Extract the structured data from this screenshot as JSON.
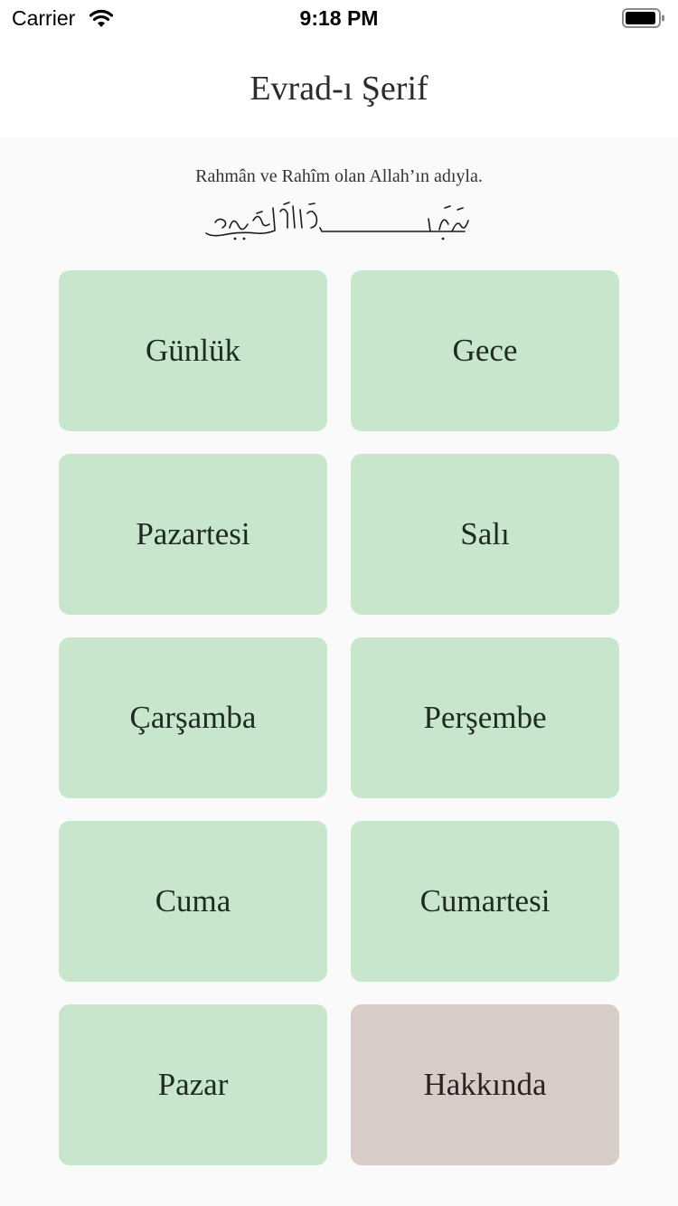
{
  "status_bar": {
    "carrier": "Carrier",
    "time": "9:18 PM",
    "wifi_icon": "wifi-icon",
    "battery_icon": "battery-icon"
  },
  "nav": {
    "title": "Evrad-ı Şerif"
  },
  "header": {
    "subtitle": "Rahmân ve Rahîm olan Allah’ın adıyla.",
    "calligraphy_icon": "besmele-calligraphy"
  },
  "tiles": [
    {
      "label": "Günlük"
    },
    {
      "label": "Gece"
    },
    {
      "label": "Pazartesi"
    },
    {
      "label": "Salı"
    },
    {
      "label": "Çarşamba"
    },
    {
      "label": "Perşembe"
    },
    {
      "label": "Cuma"
    },
    {
      "label": "Cumartesi"
    },
    {
      "label": "Pazar"
    },
    {
      "label": "Hakkında"
    }
  ],
  "colors": {
    "page_background": "#fafafa",
    "bar_background": "#ffffff",
    "day_tile": "#c8e6cb",
    "about_tile": "#d7ccc8"
  }
}
